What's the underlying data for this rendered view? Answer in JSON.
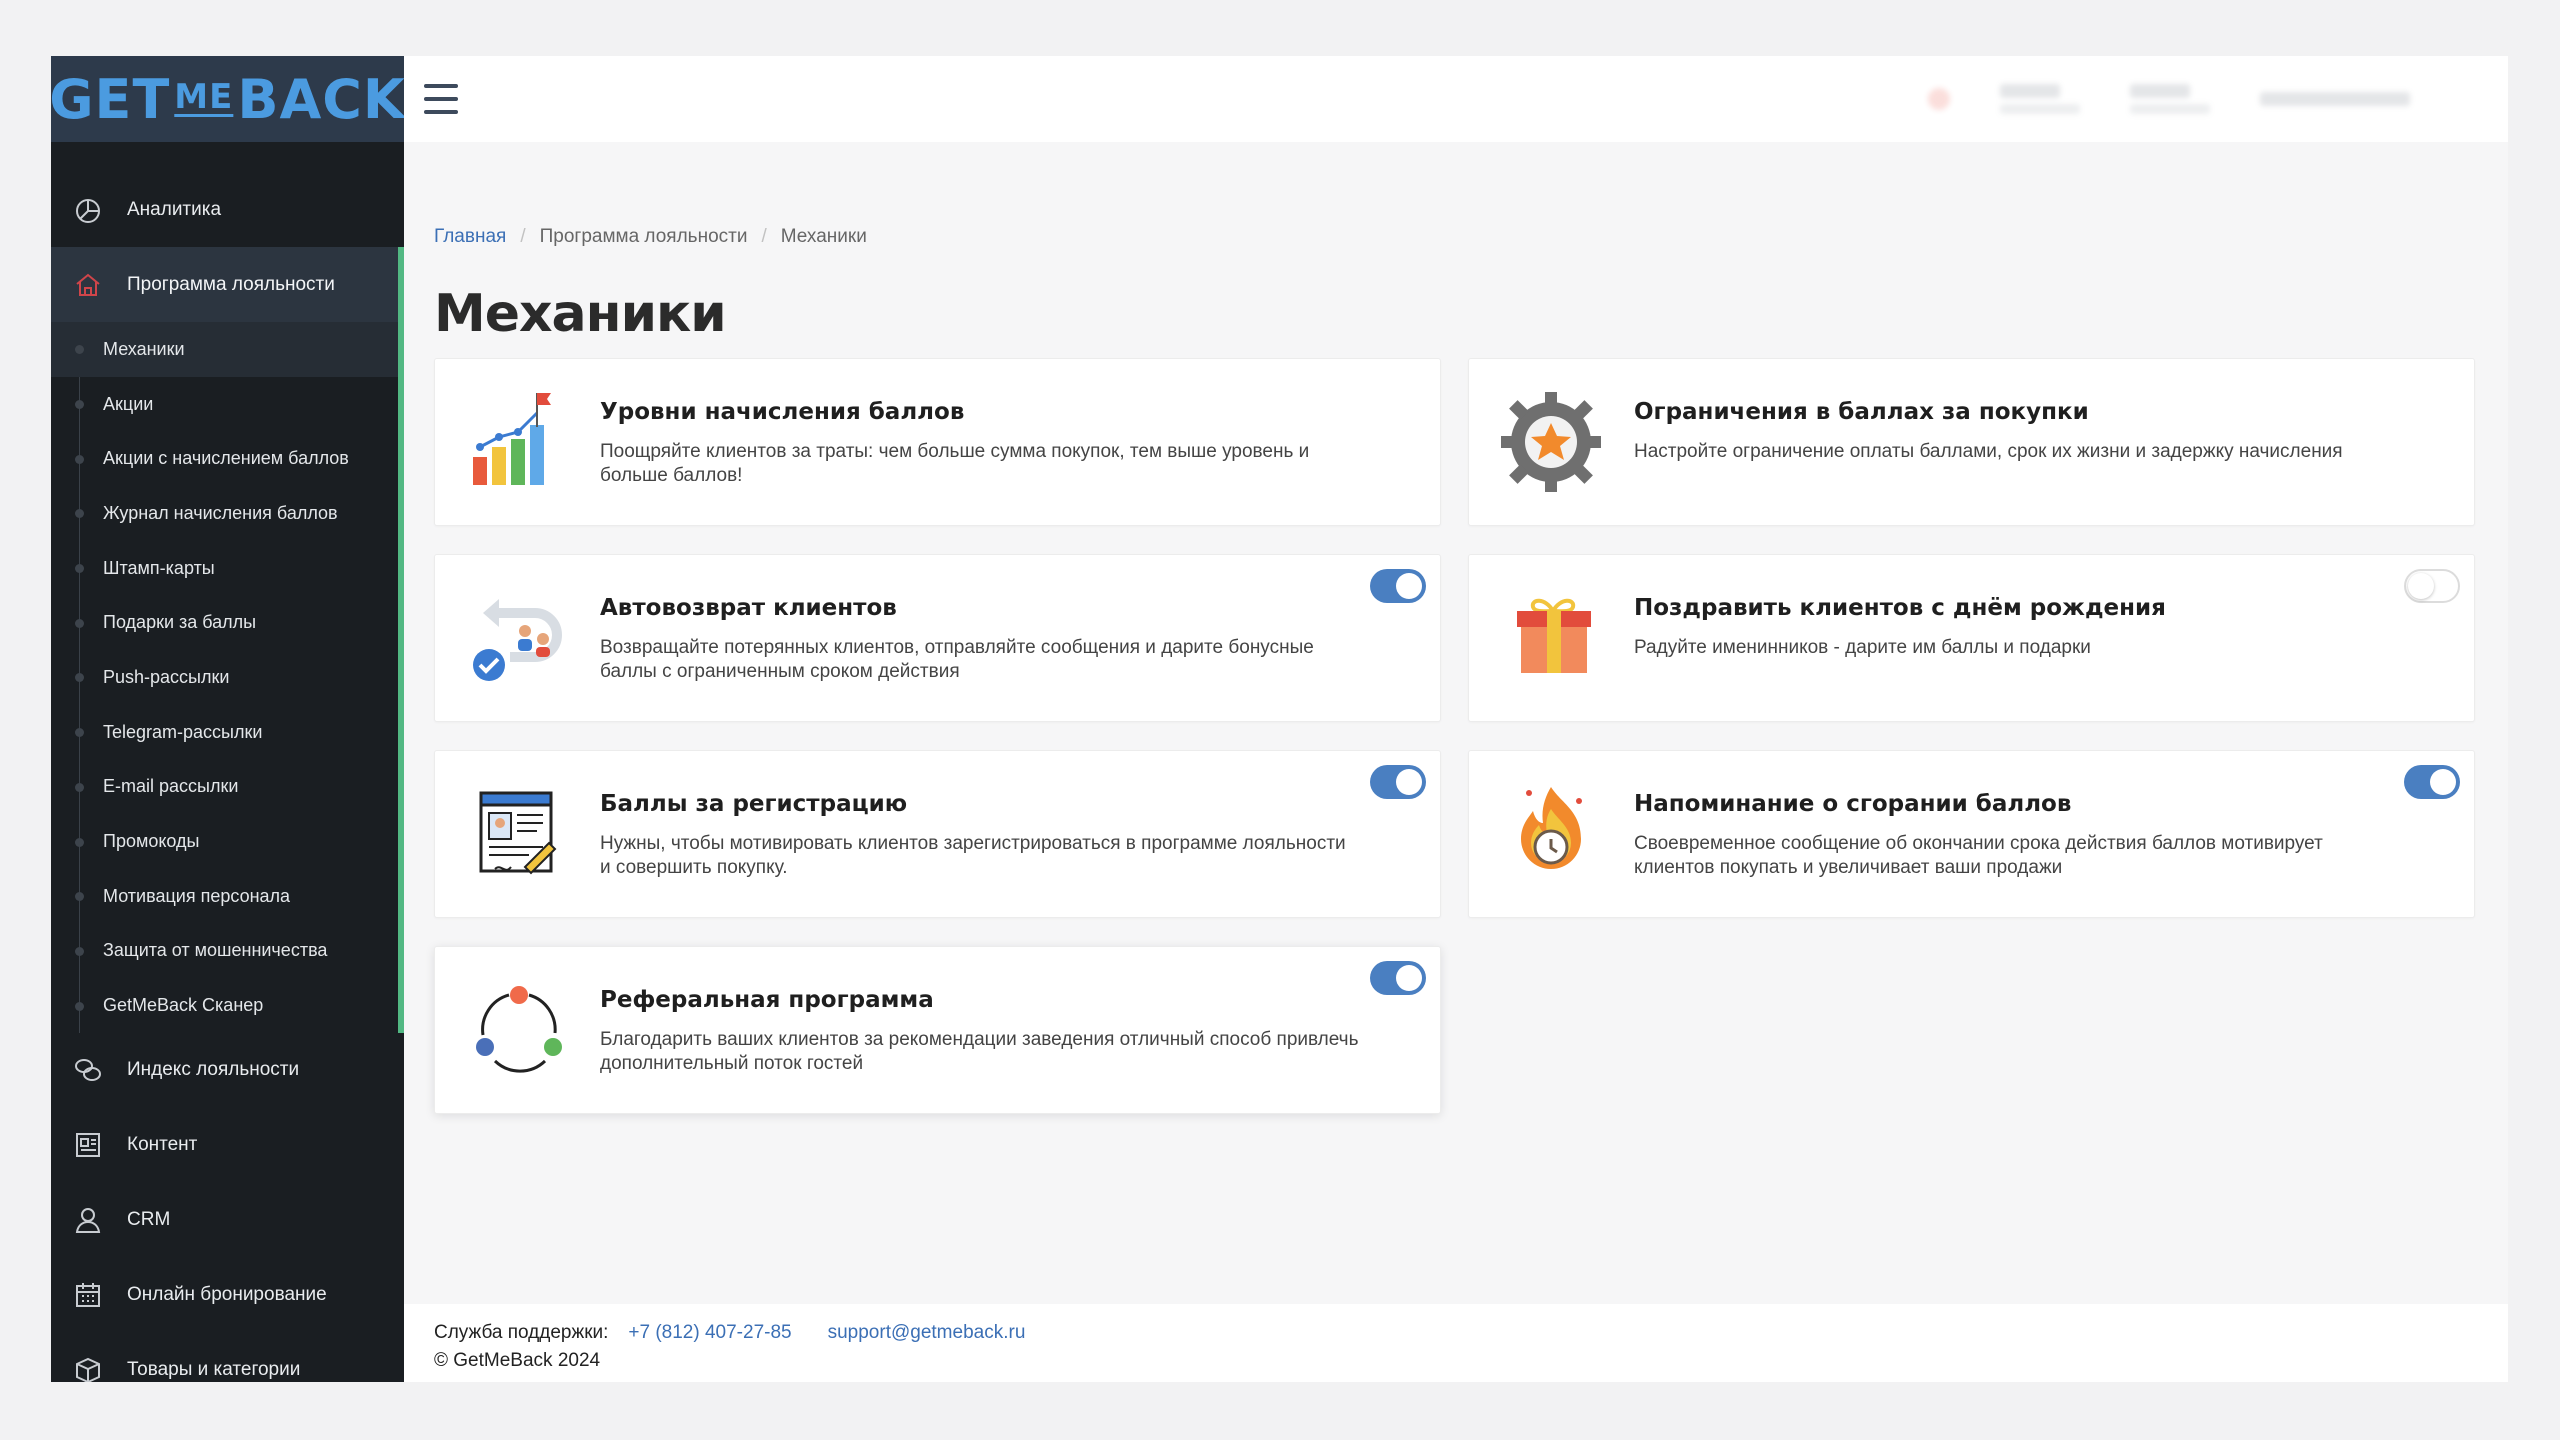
{
  "app": {
    "logo": {
      "part1": "GET",
      "part2": "ME",
      "part3": "BACK"
    }
  },
  "sidebar": {
    "items": [
      {
        "label": "Аналитика",
        "icon": "pie-chart-icon"
      },
      {
        "label": "Программа лояльности",
        "icon": "home-icon",
        "active": true
      }
    ],
    "sub_items": [
      {
        "label": "Механики",
        "active": true
      },
      {
        "label": "Акции"
      },
      {
        "label": "Акции с начислением баллов"
      },
      {
        "label": "Журнал начисления баллов"
      },
      {
        "label": "Штамп-карты"
      },
      {
        "label": "Подарки за баллы"
      },
      {
        "label": "Push-рассылки"
      },
      {
        "label": "Telegram-рассылки"
      },
      {
        "label": "E-mail рассылки"
      },
      {
        "label": "Промокоды"
      },
      {
        "label": "Мотивация персонала"
      },
      {
        "label": "Защита от мошенничества"
      },
      {
        "label": "GetMeBack Сканер"
      }
    ],
    "after_items": [
      {
        "label": "Индекс лояльности",
        "icon": "chat-bubbles-icon"
      },
      {
        "label": "Контент",
        "icon": "newspaper-icon"
      },
      {
        "label": "CRM",
        "icon": "user-icon"
      },
      {
        "label": "Онлайн бронирование",
        "icon": "calendar-icon"
      },
      {
        "label": "Товары и категории",
        "icon": "box-icon"
      }
    ]
  },
  "breadcrumb": {
    "home": "Главная",
    "section": "Программа лояльности",
    "current": "Механики"
  },
  "page": {
    "title": "Механики"
  },
  "cards": [
    {
      "title": "Уровни начисления баллов",
      "desc": "Поощряйте клиентов за траты: чем больше сумма покупок, тем выше уровень и больше баллов!",
      "icon": "bar-chart-flag-icon"
    },
    {
      "title": "Ограничения в баллах за покупки",
      "desc": "Настройте ограничение оплаты баллами, срок их жизни и задержку начисления",
      "icon": "gear-star-icon"
    },
    {
      "title": "Автовозврат клиентов",
      "desc": "Возвращайте потерянных клиентов, отправляйте сообщения и дарите бонусные баллы с ограниченным сроком действия",
      "icon": "return-users-icon",
      "toggle": true
    },
    {
      "title": "Поздравить клиентов с днём рождения",
      "desc": "Радуйте именинников - дарите им баллы и подарки",
      "icon": "gift-icon",
      "toggle": false
    },
    {
      "title": "Баллы за регистрацию",
      "desc": "Нужны, чтобы мотивировать клиентов зарегистрироваться в программе лояльности и совершить покупку.",
      "icon": "registration-form-icon",
      "toggle": true
    },
    {
      "title": "Напоминание о сгорании баллов",
      "desc": "Своевременное сообщение об окончании срока действия баллов мотивирует клиентов покупать и увеличивает ваши продажи",
      "icon": "fire-clock-icon",
      "toggle": true
    },
    {
      "title": "Реферальная программа",
      "desc": "Благодарить ваших клиентов за рекомендации заведения отличный способ привлечь дополнительный поток гостей",
      "icon": "referral-cycle-icon",
      "toggle": true
    }
  ],
  "footer": {
    "support_label": "Служба поддержки:",
    "phone": "+7 (812) 407-27-85",
    "email": "support@getmeback.ru",
    "copyright": "© GetMeBack 2024"
  },
  "colors": {
    "accent": "#4a7fc1",
    "sidebar_bg": "#1a1e22",
    "active_marker": "#52b883",
    "logo": "#4b9be0"
  }
}
